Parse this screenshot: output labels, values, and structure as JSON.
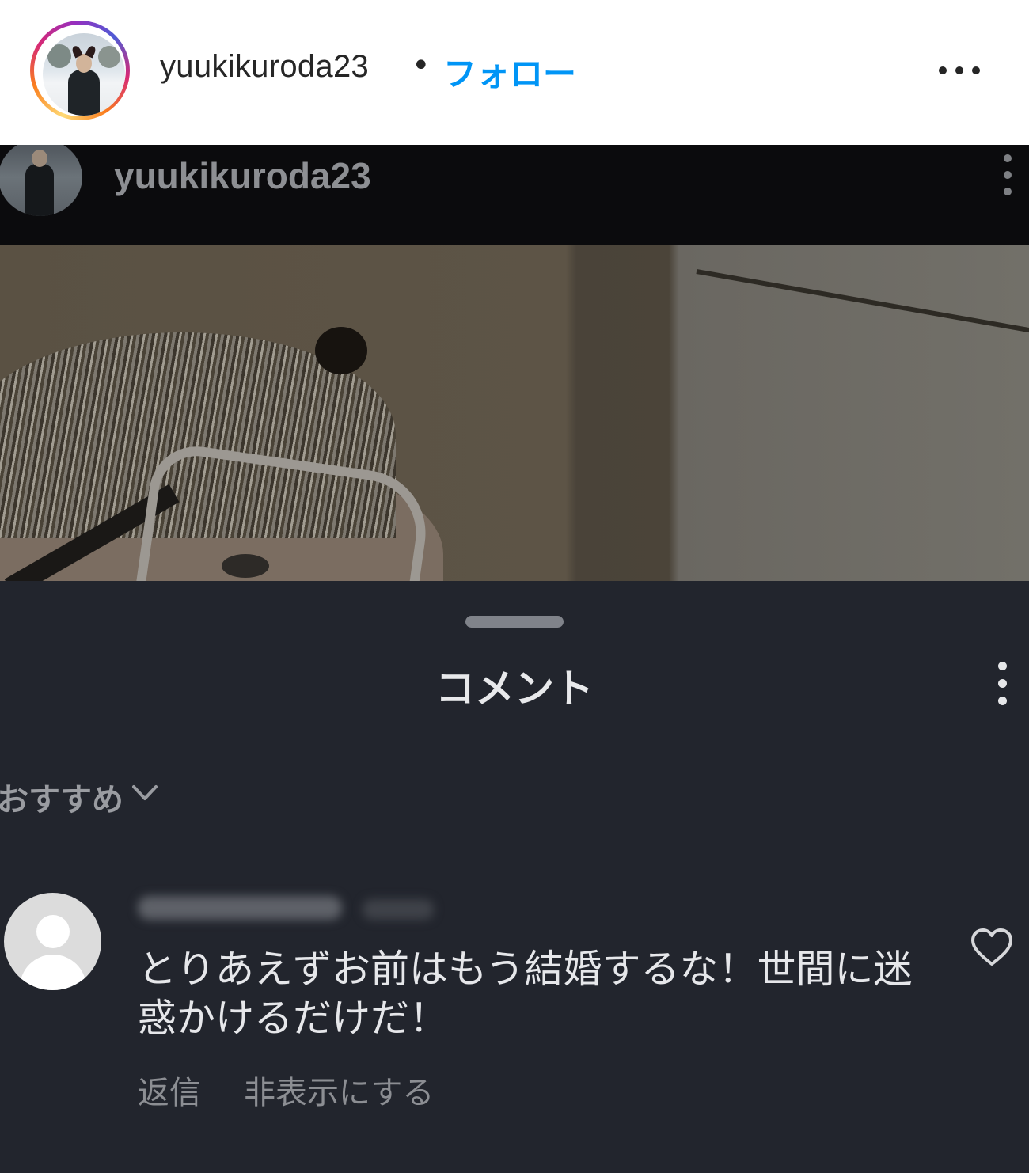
{
  "header": {
    "username": "yuukikuroda23",
    "separator": "•",
    "follow_label": "フォロー",
    "more_icon": "more-horizontal-icon",
    "ring_colors": [
      "#feda75",
      "#fa7e1e",
      "#d62976",
      "#962fbf",
      "#4f5bd5"
    ]
  },
  "post": {
    "inner_username": "yuukikuroda23",
    "inner_more_icon": "more-vertical-icon"
  },
  "comments_sheet": {
    "title": "コメント",
    "sort_label": "おすすめ",
    "comment": {
      "text": "とりあえずお前はもう結婚するな！世間に迷惑かけるだけだ！",
      "reply_label": "返信",
      "hide_label": "非表示にする"
    }
  },
  "colors": {
    "follow_blue": "#0095f6",
    "sheet_bg": "#22252d",
    "text_primary": "#e6e7ea",
    "text_secondary": "#8c8e93"
  }
}
